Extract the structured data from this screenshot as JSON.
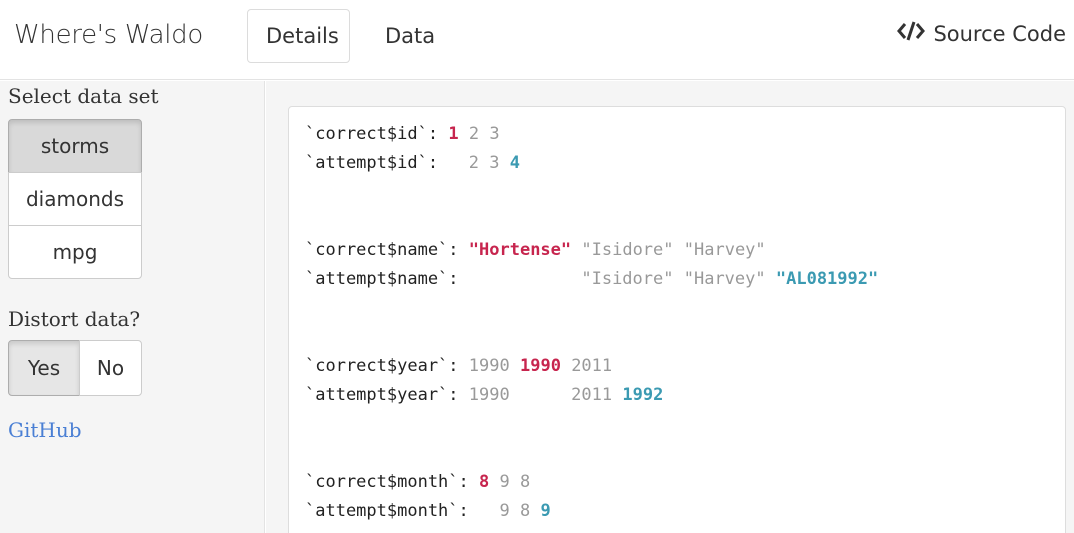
{
  "navbar": {
    "brand": "Where's Waldo",
    "tabs": [
      {
        "label": "Details",
        "active": true
      },
      {
        "label": "Data",
        "active": false
      }
    ],
    "source_label": "Source Code",
    "source_icon": "code-icon"
  },
  "sidebar": {
    "dataset_label": "Select data set",
    "datasets": [
      {
        "label": "storms",
        "selected": true
      },
      {
        "label": "diamonds",
        "selected": false
      },
      {
        "label": "mpg",
        "selected": false
      }
    ],
    "distort_label": "Distort data?",
    "distort_options": [
      {
        "label": "Yes",
        "selected": true
      },
      {
        "label": "No",
        "selected": false
      }
    ],
    "github_link": "GitHub"
  },
  "diff": {
    "id": {
      "correct_label": "`correct$id`",
      "attempt_label": "`attempt$id`",
      "correct_values": [
        "1",
        "2",
        "3"
      ],
      "attempt_values": [
        "2",
        "3",
        "4"
      ]
    },
    "name": {
      "correct_label": "`correct$name`",
      "attempt_label": "`attempt$name`",
      "correct_values": [
        "\"Hortense\"",
        "\"Isidore\"",
        "\"Harvey\""
      ],
      "attempt_values": [
        "\"Isidore\"",
        "\"Harvey\"",
        "\"AL081992\""
      ]
    },
    "year": {
      "correct_label": "`correct$year`",
      "attempt_label": "`attempt$year`",
      "correct_values": [
        "1990",
        "1990",
        "2011"
      ],
      "attempt_values": [
        "1990",
        "2011",
        "1992"
      ]
    },
    "month": {
      "correct_label": "`correct$month`",
      "attempt_label": "`attempt$month`",
      "correct_values": [
        "8",
        "9",
        "8"
      ],
      "attempt_values": [
        "9",
        "8",
        "9"
      ]
    }
  },
  "colors": {
    "removed": "#c7254e",
    "added": "#3b9ab2",
    "unchanged": "#999999",
    "link": "#4a7fd4"
  }
}
